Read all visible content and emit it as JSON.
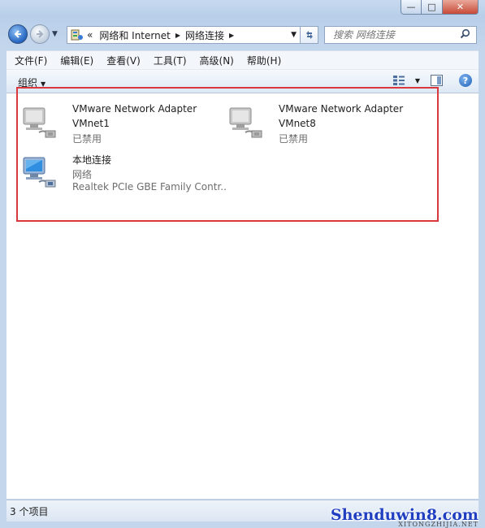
{
  "window": {
    "minimize_glyph": "—",
    "maximize_glyph": "□",
    "close_glyph": "✕"
  },
  "nav": {
    "address_prefix": "«",
    "breadcrumbs": [
      "网络和 Internet",
      "网络连接"
    ],
    "search_placeholder": "搜索 网络连接"
  },
  "menu": [
    "文件(F)",
    "编辑(E)",
    "查看(V)",
    "工具(T)",
    "高级(N)",
    "帮助(H)"
  ],
  "toolbar": {
    "organize_label": "组织",
    "help_glyph": "?"
  },
  "connections": [
    {
      "name": "VMware Network Adapter",
      "device": "VMnet1",
      "status": "已禁用",
      "icon": "network-adapter-disabled-icon"
    },
    {
      "name": "VMware Network Adapter",
      "device": "VMnet8",
      "status": "已禁用",
      "icon": "network-adapter-disabled-icon"
    },
    {
      "name": "本地连接",
      "device": "网络",
      "status": "Realtek PCIe GBE Family Contr...",
      "icon": "network-adapter-connected-icon"
    }
  ],
  "status_bar": {
    "item_count": "3 个项目"
  },
  "watermark": {
    "brand": "Shenduwin8.com",
    "sub": "XITONGZHIJIA.NET"
  },
  "colors": {
    "highlight_border": "#d9393e",
    "frame": "#c3d6ec",
    "watermark": "#1f3fc0"
  }
}
